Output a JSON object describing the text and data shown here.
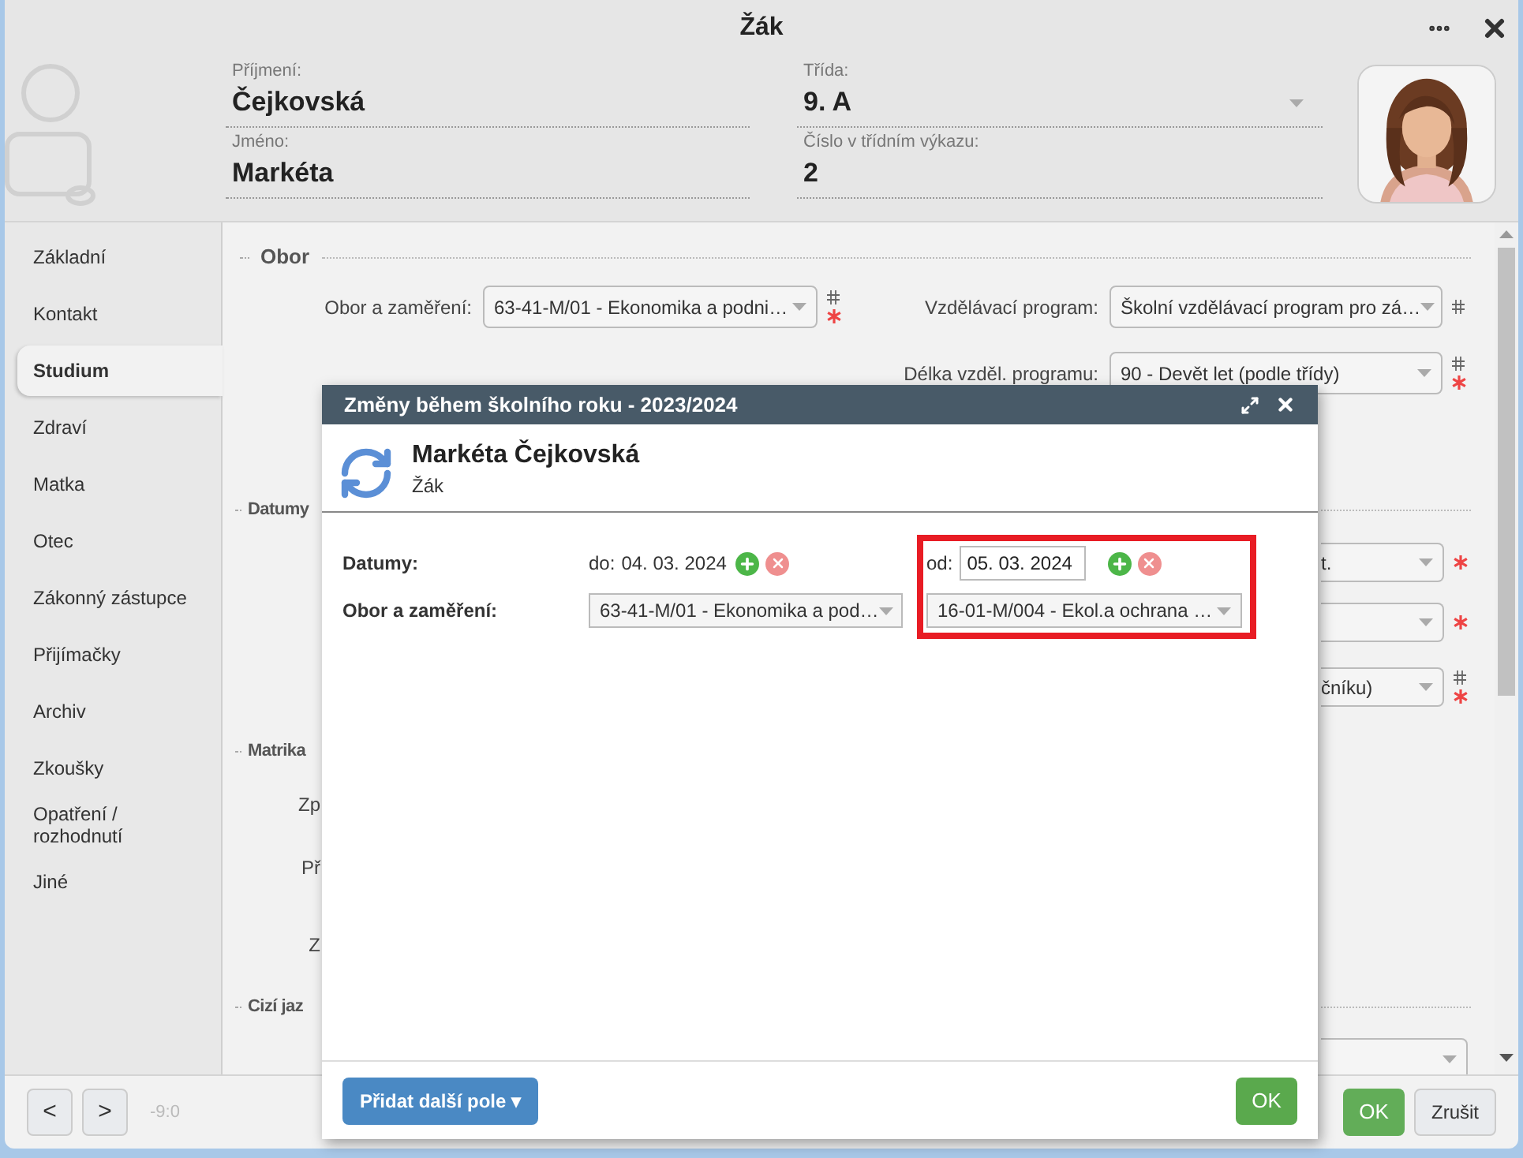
{
  "window": {
    "title": "Žák"
  },
  "header": {
    "fields": [
      {
        "label": "Příjmení:",
        "value": "Čejkovská",
        "kind": "text"
      },
      {
        "label": "Jméno:",
        "value": "Markéta",
        "kind": "text"
      },
      {
        "label": "Třída:",
        "value": "9. A",
        "kind": "select"
      },
      {
        "label": "Číslo v třídním výkazu:",
        "value": "2",
        "kind": "text"
      }
    ]
  },
  "sidebar": {
    "items": [
      {
        "label": "Základní",
        "selected": false
      },
      {
        "label": "Kontakt",
        "selected": false
      },
      {
        "label": "Studium",
        "selected": true
      },
      {
        "label": "Zdraví",
        "selected": false
      },
      {
        "label": "Matka",
        "selected": false
      },
      {
        "label": "Otec",
        "selected": false
      },
      {
        "label": "Zákonný zástupce",
        "selected": false
      },
      {
        "label": "Přijímačky",
        "selected": false
      },
      {
        "label": "Archiv",
        "selected": false
      },
      {
        "label": "Zkoušky",
        "selected": false
      },
      {
        "label": "Opatření / rozhodnutí",
        "selected": false
      },
      {
        "label": "Jiné",
        "selected": false
      }
    ]
  },
  "form": {
    "title": "Obor",
    "rows": [
      {
        "left": {
          "label": "Obor a zaměření:",
          "value": "63-41-M/01 - Ekonomika a podni…",
          "hash": true,
          "required": true
        },
        "right": {
          "label": "Vzdělávací program:",
          "value": "Školní vzdělávací program pro zá…",
          "hash": true,
          "required": false
        }
      },
      {
        "right": {
          "label": "Délka vzděl. programu:",
          "value": "90 - Devět let (podle třídy)",
          "hash": true,
          "required": true
        }
      }
    ],
    "left_fragments": [
      {
        "kind": "heading",
        "text": "Datumy"
      },
      {
        "kind": "heading",
        "text": "Matrika"
      },
      {
        "kind": "label",
        "text": "Zp"
      },
      {
        "kind": "label",
        "text": "Př"
      },
      {
        "kind": "label",
        "text": "Z"
      },
      {
        "kind": "heading",
        "text": "Cizí jaz"
      }
    ],
    "right_fragments": [
      {
        "value": "t.",
        "hash": false,
        "required": true
      },
      {
        "hash": false,
        "required": true
      },
      {
        "value": "čníku)",
        "hash": true,
        "required": true
      },
      {
        "hash": false,
        "required": false
      }
    ]
  },
  "dialog": {
    "title": "Změny během školního roku - 2023/2024",
    "name": "Markéta Čejkovská",
    "role": "Žák",
    "labels": [
      "Datumy:",
      "Obor a zaměření:"
    ],
    "columns": [
      {
        "date_prefix": "do:",
        "date": "04. 03. 2024",
        "editable": false,
        "obor": "63-41-M/01 - Ekonomika a pod…",
        "highlighted": false
      },
      {
        "date_prefix": "od:",
        "date": "05. 03. 2024",
        "editable": true,
        "obor": "16-01-M/004 - Ekol.a ochrana …",
        "highlighted": true
      }
    ],
    "add_button": "Přidat další pole ▾",
    "ok": "OK"
  },
  "footer": {
    "prev": "<",
    "next": ">",
    "counter": "-9:0",
    "ok": "OK",
    "cancel": "Zrušit"
  }
}
